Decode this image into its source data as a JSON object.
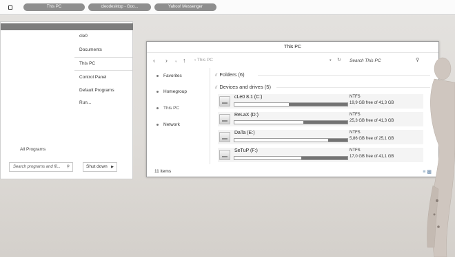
{
  "taskbar": {
    "buttons": [
      "This PC",
      "cleodesktop - Goo...",
      "Yahoo! Messenger"
    ]
  },
  "start_menu": {
    "right_items": [
      "cle0",
      "Documents",
      "This PC",
      "Control Panel",
      "Default Programs",
      "Run..."
    ],
    "all_programs": "All Programs",
    "search_placeholder": "Search programs and fil...",
    "shutdown_label": "Shut down"
  },
  "explorer": {
    "title": "This PC",
    "address": "This PC",
    "search_placeholder": "Search This PC",
    "sidebar": [
      "Favorites",
      "Homegroup",
      "This PC",
      "Network"
    ],
    "folders_header": "Folders (6)",
    "devices_header": "Devices and drives (5)",
    "drives": [
      {
        "name": "cLe0 8.1 (C:)",
        "fs": "NTFS",
        "free": "19,9 GB free of 41,3 GB",
        "used_fraction": 0.52
      },
      {
        "name": "ReLaX (D:)",
        "fs": "NTFS",
        "free": "25,3 GB free of 41,3 GB",
        "used_fraction": 0.39
      },
      {
        "name": "DaTa (E:)",
        "fs": "NTFS",
        "free": "5,86 GB free of 25,1 GB",
        "used_fraction": 0.17
      },
      {
        "name": "SeTuP (F:)",
        "fs": "NTFS",
        "free": "17,0 GB free of 41,1 GB",
        "used_fraction": 0.41
      }
    ],
    "status": "11 items"
  },
  "colors": {
    "taskbar_button": "#8e8e8e",
    "start_header": "#7d7d7d",
    "drive_fill": "#737373"
  }
}
